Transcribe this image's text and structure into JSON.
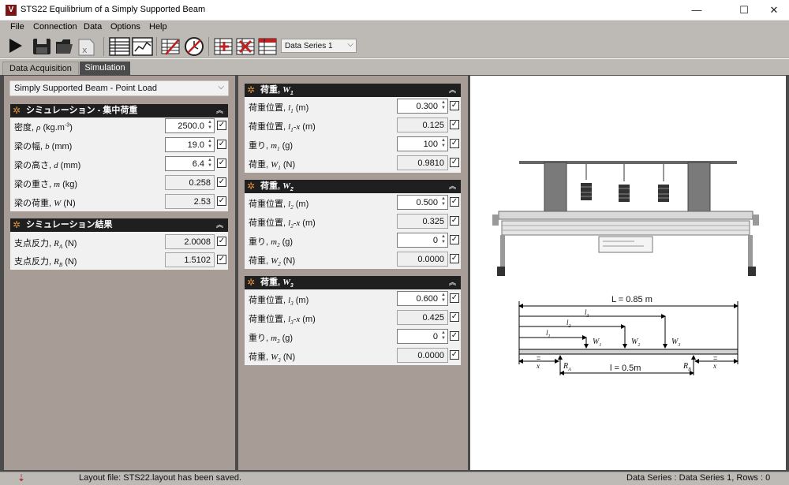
{
  "window": {
    "logo": "V",
    "title": "STS22 Equilibrium of a Simply Supported Beam",
    "controls": {
      "minimize": "—",
      "maximize": "☐",
      "close": "✕"
    }
  },
  "menu": [
    {
      "id": "file",
      "label": "File"
    },
    {
      "id": "connection",
      "label": "Connection"
    },
    {
      "id": "data",
      "label": "Data"
    },
    {
      "id": "options",
      "label": "Options"
    },
    {
      "id": "help",
      "label": "Help"
    }
  ],
  "toolbar": {
    "icons": [
      "play-icon",
      "save-icon",
      "open-folder-icon",
      "excel-export-icon",
      "table-view-icon",
      "graph-view-icon",
      "edit-table-icon",
      "clock-icon",
      "add-series-icon",
      "delete-series-icon",
      "series-table-icon"
    ],
    "series_select": "Data Series 1"
  },
  "tabs": {
    "daq": "Data Acquisition",
    "sim": "Simulation"
  },
  "left": {
    "preset": "Simply Supported Beam - Point Load",
    "sim_panel": {
      "title": "シミュレーション - 集中荷重",
      "rows": [
        {
          "label": "密度, ",
          "sym": "ρ",
          "unit": " (kg.m",
          "sup": "-3",
          "unit2": ")",
          "value": "2500.0",
          "editable": true
        },
        {
          "label": "梁の幅, ",
          "sym": "b",
          "unit": " (mm)",
          "value": "19.0",
          "editable": true
        },
        {
          "label": "梁の高さ, ",
          "sym": "d",
          "unit": " (mm)",
          "value": "6.4",
          "editable": true
        },
        {
          "label": "梁の重さ, ",
          "sym": "m",
          "unit": " (kg)",
          "value": "0.258",
          "editable": false
        },
        {
          "label": "梁の荷重, ",
          "sym": "W",
          "unit": " (N)",
          "value": "2.53",
          "editable": false
        }
      ]
    },
    "result_panel": {
      "title": "シミュレーション結果",
      "rows": [
        {
          "label": "支点反力, ",
          "sym": "R",
          "sub": "A",
          "unit": " (N)",
          "value": "2.0008"
        },
        {
          "label": "支点反力, ",
          "sym": "R",
          "sub": "B",
          "unit": " (N)",
          "value": "1.5102"
        }
      ]
    }
  },
  "loads": [
    {
      "title": "荷重, ",
      "sym": "W",
      "sub": "1",
      "rows": [
        {
          "label": "荷重位置, ",
          "sym": "l",
          "sub": "1",
          "tail": "",
          "unit": " (m)",
          "value": "0.300",
          "editable": true
        },
        {
          "label": "荷重位置, ",
          "sym": "l",
          "sub": "1",
          "tail": "-x",
          "unit": " (m)",
          "value": "0.125",
          "editable": false
        },
        {
          "label": "重り, ",
          "sym": "m",
          "sub": "1",
          "tail": "",
          "unit": " (g)",
          "value": "100",
          "editable": true
        },
        {
          "label": "荷重, ",
          "sym": "W",
          "sub": "1",
          "tail": "",
          "unit": " (N)",
          "value": "0.9810",
          "editable": false
        }
      ]
    },
    {
      "title": "荷重, ",
      "sym": "W",
      "sub": "2",
      "rows": [
        {
          "label": "荷重位置, ",
          "sym": "l",
          "sub": "2",
          "tail": "",
          "unit": " (m)",
          "value": "0.500",
          "editable": true
        },
        {
          "label": "荷重位置, ",
          "sym": "l",
          "sub": "2",
          "tail": "-x",
          "unit": " (m)",
          "value": "0.325",
          "editable": false
        },
        {
          "label": "重り, ",
          "sym": "m",
          "sub": "2",
          "tail": "",
          "unit": " (g)",
          "value": "0",
          "editable": true
        },
        {
          "label": "荷重, ",
          "sym": "W",
          "sub": "2",
          "tail": "",
          "unit": " (N)",
          "value": "0.0000",
          "editable": false
        }
      ]
    },
    {
      "title": "荷重, ",
      "sym": "W",
      "sub": "3",
      "rows": [
        {
          "label": "荷重位置, ",
          "sym": "l",
          "sub": "3",
          "tail": "",
          "unit": " (m)",
          "value": "0.600",
          "editable": true
        },
        {
          "label": "荷重位置, ",
          "sym": "l",
          "sub": "3",
          "tail": "-x",
          "unit": " (m)",
          "value": "0.425",
          "editable": false
        },
        {
          "label": "重り, ",
          "sym": "m",
          "sub": "3",
          "tail": "",
          "unit": " (g)",
          "value": "0",
          "editable": true
        },
        {
          "label": "荷重, ",
          "sym": "W",
          "sub": "3",
          "tail": "",
          "unit": " (N)",
          "value": "0.0000",
          "editable": false
        }
      ]
    }
  ],
  "diagram": {
    "L": "L = 0.85 m",
    "l3": "l",
    "l3_sub": "3",
    "l2": "l",
    "l2_sub": "2",
    "l1": "l",
    "l1_sub": "1",
    "W1": "W",
    "W1_sub": "1",
    "W2": "W",
    "W2_sub": "2",
    "W3": "W",
    "W3_sub": "3",
    "RA": "R",
    "RA_sub": "A",
    "RB": "R",
    "RB_sub": "B",
    "x_left": "x",
    "x_right": "x",
    "eq_left": "=",
    "eq_right": "=",
    "l_span": "l = 0.5m"
  },
  "status": {
    "left": "Layout file: STS22.layout has been saved.",
    "right": "Data Series : Data Series 1,  Rows : 0"
  }
}
